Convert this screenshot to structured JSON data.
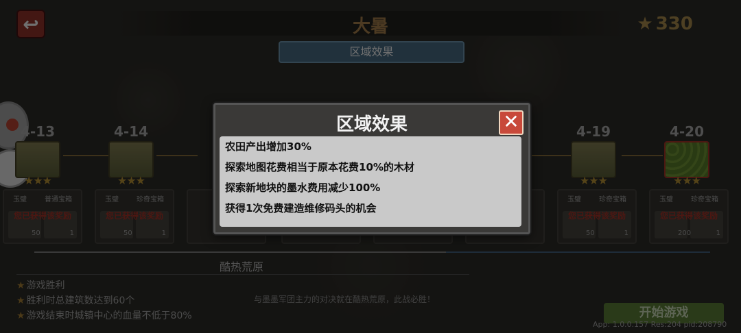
{
  "header": {
    "back_icon": "back-arrow-icon",
    "title": "大暑",
    "stars": "330",
    "region_tab": "区域效果"
  },
  "levels": [
    {
      "label": "4-13"
    },
    {
      "label": "4-14"
    },
    {
      "label": "4-19"
    },
    {
      "label": "4-20"
    }
  ],
  "rewards": [
    {
      "left": "玉璧",
      "right": "普通宝箱",
      "status": "您已获得该奖励",
      "n1": "50",
      "n2": "1"
    },
    {
      "left": "玉璧",
      "right": "珍奇宝箱",
      "status": "您已获得该奖励",
      "n1": "50",
      "n2": "1"
    },
    {
      "left": "玉璧",
      "right": "珍奇宝箱",
      "status": "您已获得该奖励",
      "n1": "50",
      "n2": "1"
    },
    {
      "left": "玉璧",
      "right": "珍奇宝箱",
      "status": "您已获得该奖励",
      "n1": "200",
      "n2": "1"
    }
  ],
  "area": {
    "name": "酷热荒原",
    "goals": [
      "游戏胜利",
      "胜利时总建筑数达到60个",
      "游戏结束时城镇中心的血量不低于80%"
    ],
    "flavor": "与墨墨军团主力的对决就在酷热荒原，此战必胜！"
  },
  "start_button": "开始游戏",
  "version": "App: 1.0.0.157 Res:204 pid:208790",
  "modal": {
    "title": "区域效果",
    "close_label": "✕",
    "effects": [
      "农田产出增加30%",
      "探索地图花费相当于原本花费10%的木材",
      "探索新地块的墨水费用减少100%",
      "获得1次免费建造维修码头的机会"
    ]
  }
}
